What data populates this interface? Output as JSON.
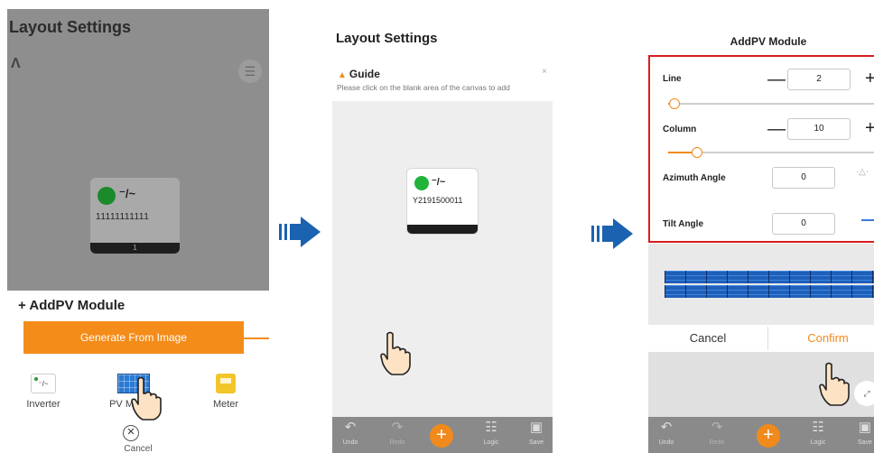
{
  "colors": {
    "accent_orange": "#f48c1a",
    "highlight_red": "#d81e1e",
    "arrow_blue": "#1b62b0",
    "status_green": "#1a8a2a"
  },
  "panel1": {
    "title": "Layout Settings",
    "logo_icon": "logo-icon",
    "device": {
      "symbol": "⁻/~",
      "serial": "11111111111",
      "index": "1"
    },
    "sheet": {
      "title": "+ AddPV Module",
      "generate_button": "Generate From Image",
      "devices": [
        {
          "label": "Inverter",
          "icon": "inverter-icon"
        },
        {
          "label": "PV Module",
          "icon": "pv-module-icon"
        },
        {
          "label": "Meter",
          "icon": "meter-icon"
        }
      ],
      "cancel_label": "Cancel"
    }
  },
  "panel2": {
    "title": "Layout Settings",
    "guide": {
      "heading": "Guide",
      "text": "Please click on the blank area of the canvas to add",
      "close": "×"
    },
    "device": {
      "symbol": "⁻/~",
      "serial": "Y2191500011"
    },
    "toolbar": {
      "undo": "Undo",
      "redo": "Redo",
      "logic": "Logic",
      "save": "Save"
    }
  },
  "panel3": {
    "title": "AddPV Module",
    "line": {
      "label": "Line",
      "value": "2",
      "slider_fraction": 0.03
    },
    "column": {
      "label": "Column",
      "value": "10",
      "slider_fraction": 0.14
    },
    "azimuth": {
      "label": "Azimuth Angle",
      "value": "0"
    },
    "tilt": {
      "label": "Tilt Angle",
      "value": "0"
    },
    "cancel": "Cancel",
    "confirm": "Confirm",
    "toolbar": {
      "undo": "Undo",
      "redo": "Redo",
      "logic": "Logic",
      "save": "Save"
    }
  }
}
